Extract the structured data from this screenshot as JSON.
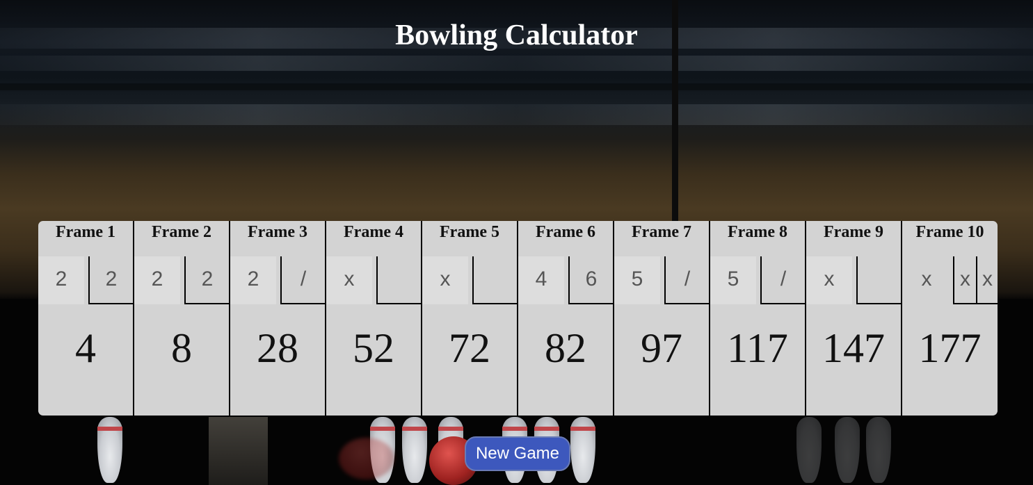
{
  "app": {
    "title": "Bowling Calculator"
  },
  "frames": [
    {
      "label": "Frame 1",
      "rolls": [
        "2",
        "2"
      ],
      "total": "4"
    },
    {
      "label": "Frame 2",
      "rolls": [
        "2",
        "2"
      ],
      "total": "8"
    },
    {
      "label": "Frame 3",
      "rolls": [
        "2",
        "/"
      ],
      "total": "28"
    },
    {
      "label": "Frame 4",
      "rolls": [
        "x",
        ""
      ],
      "total": "52"
    },
    {
      "label": "Frame 5",
      "rolls": [
        "x",
        ""
      ],
      "total": "72"
    },
    {
      "label": "Frame 6",
      "rolls": [
        "4",
        "6"
      ],
      "total": "82"
    },
    {
      "label": "Frame 7",
      "rolls": [
        "5",
        "/"
      ],
      "total": "97"
    },
    {
      "label": "Frame 8",
      "rolls": [
        "5",
        "/"
      ],
      "total": "117"
    },
    {
      "label": "Frame 9",
      "rolls": [
        "x",
        ""
      ],
      "total": "147"
    },
    {
      "label": "Frame 10",
      "rolls": [
        "x",
        "x",
        "x"
      ],
      "total": "177"
    }
  ],
  "actions": {
    "new_game_label": "New Game"
  },
  "colors": {
    "board": "#d3d3d3",
    "button": "#3d58bd",
    "title": "#ffffff"
  }
}
